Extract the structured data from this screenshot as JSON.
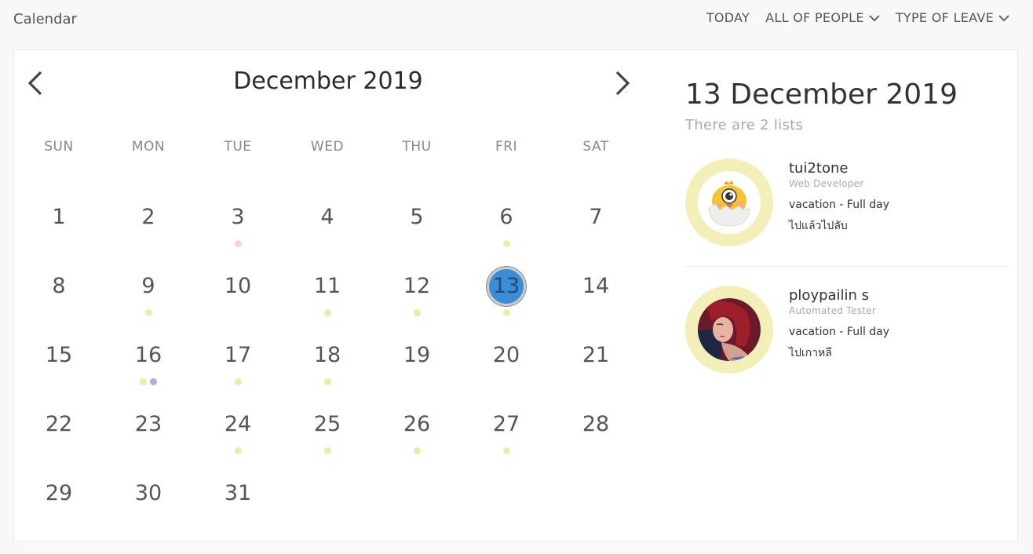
{
  "app": {
    "title": "Calendar"
  },
  "topnav": {
    "today": "TODAY",
    "people": "ALL OF PEOPLE",
    "leave_type": "TYPE OF LEAVE"
  },
  "colors": {
    "selected": "#3a8dd9",
    "dot_yellow": "#ececa6",
    "dot_pink": "#f5d3dc",
    "dot_purple": "#b3acd6",
    "avatar_ring": "#f2f0b8"
  },
  "calendar": {
    "month_title": "December 2019",
    "prev_icon": "chevron-left-icon",
    "next_icon": "chevron-right-icon",
    "weekdays": [
      "SUN",
      "MON",
      "TUE",
      "WED",
      "THU",
      "FRI",
      "SAT"
    ],
    "selected_day": 13,
    "weeks": [
      [
        {
          "day": "1",
          "dots": []
        },
        {
          "day": "2",
          "dots": []
        },
        {
          "day": "3",
          "dots": [
            "pink"
          ]
        },
        {
          "day": "4",
          "dots": []
        },
        {
          "day": "5",
          "dots": []
        },
        {
          "day": "6",
          "dots": [
            "yellow"
          ]
        },
        {
          "day": "7",
          "dots": []
        }
      ],
      [
        {
          "day": "8",
          "dots": []
        },
        {
          "day": "9",
          "dots": [
            "yellow"
          ]
        },
        {
          "day": "10",
          "dots": []
        },
        {
          "day": "11",
          "dots": [
            "yellow"
          ]
        },
        {
          "day": "12",
          "dots": [
            "yellow"
          ]
        },
        {
          "day": "13",
          "dots": [
            "yellow"
          ]
        },
        {
          "day": "14",
          "dots": []
        }
      ],
      [
        {
          "day": "15",
          "dots": []
        },
        {
          "day": "16",
          "dots": [
            "yellow",
            "purple"
          ]
        },
        {
          "day": "17",
          "dots": [
            "yellow"
          ]
        },
        {
          "day": "18",
          "dots": [
            "yellow"
          ]
        },
        {
          "day": "19",
          "dots": []
        },
        {
          "day": "20",
          "dots": []
        },
        {
          "day": "21",
          "dots": []
        }
      ],
      [
        {
          "day": "22",
          "dots": []
        },
        {
          "day": "23",
          "dots": []
        },
        {
          "day": "24",
          "dots": [
            "yellow"
          ]
        },
        {
          "day": "25",
          "dots": [
            "yellow"
          ]
        },
        {
          "day": "26",
          "dots": [
            "yellow"
          ]
        },
        {
          "day": "27",
          "dots": [
            "yellow"
          ]
        },
        {
          "day": "28",
          "dots": []
        }
      ],
      [
        {
          "day": "29",
          "dots": []
        },
        {
          "day": "30",
          "dots": []
        },
        {
          "day": "31",
          "dots": []
        }
      ]
    ]
  },
  "detail": {
    "title": "13 December 2019",
    "subtitle": "There are 2 lists",
    "entries": [
      {
        "name": "tui2tone",
        "role": "Web Developer",
        "leave": "vacation - Full day",
        "note": "ไปแล้วไปลับ",
        "avatar": "chick-avatar"
      },
      {
        "name": "ploypailin s",
        "role": "Automated Tester",
        "leave": "vacation - Full day",
        "note": "ไปเกาหลี",
        "avatar": "portrait-avatar"
      }
    ]
  }
}
